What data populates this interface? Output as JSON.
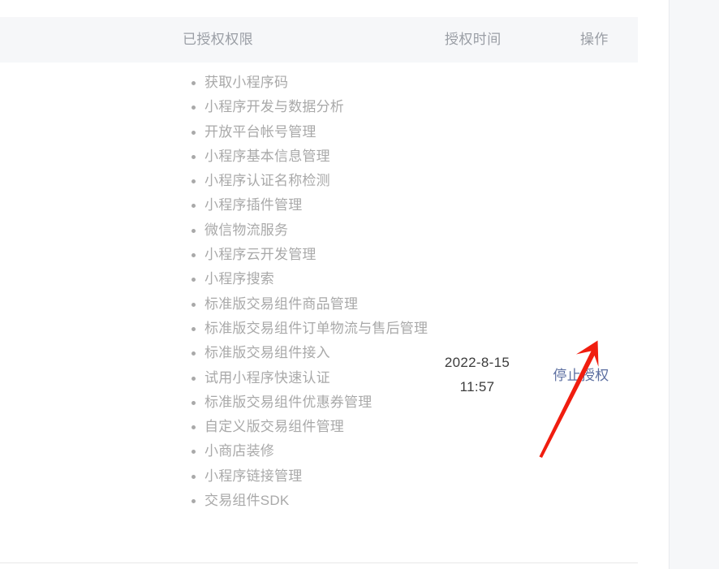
{
  "table": {
    "columns": {
      "permissions": "已授权权限",
      "grant_time": "授权时间",
      "action": "操作"
    },
    "row": {
      "permissions": [
        "获取小程序码",
        "小程序开发与数据分析",
        "开放平台帐号管理",
        "小程序基本信息管理",
        "小程序认证名称检测",
        "小程序插件管理",
        "微信物流服务",
        "小程序云开发管理",
        "小程序搜索",
        "标准版交易组件商品管理",
        "标准版交易组件订单物流与售后管理",
        "标准版交易组件接入",
        "试用小程序快速认证",
        "标准版交易组件优惠券管理",
        "自定义版交易组件管理",
        "小商店装修",
        "小程序链接管理",
        "交易组件SDK"
      ],
      "grant_date": "2022-8-15",
      "grant_clock": "11:57",
      "action_label": "停止授权"
    }
  },
  "annotation": {
    "arrow_name": "red-arrow-pointing-to-stop-authorization",
    "arrow_color": "#f01d0f"
  },
  "colors": {
    "header_background": "#f6f7f9",
    "header_text": "#9a9ea5",
    "list_text": "#a9a9a9",
    "time_text": "#3c3c3c",
    "link": "#5b6ea0",
    "divider": "#e8e8e8",
    "rail_background": "#f6f7f9"
  }
}
